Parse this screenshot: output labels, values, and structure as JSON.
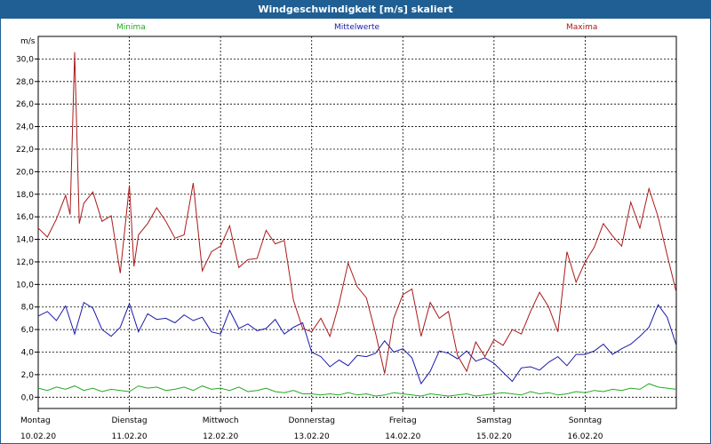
{
  "window": {
    "title": "Windgeschwindigkeit [m/s] skaliert"
  },
  "colors": {
    "minima": "#22aa22",
    "mittel": "#1a1aaa",
    "maxima": "#aa1a1a",
    "title_bg": "#1f5f94"
  },
  "chart_data": {
    "type": "line",
    "ylabel": "m/s",
    "ylim": [
      -1.0,
      32.0
    ],
    "yticks": [
      "0,0",
      "2,0",
      "4,0",
      "6,0",
      "8,0",
      "10,0",
      "12,0",
      "14,0",
      "16,0",
      "18,0",
      "20,0",
      "22,0",
      "24,0",
      "26,0",
      "28,0",
      "30,0"
    ],
    "ytick_values": [
      0,
      2,
      4,
      6,
      8,
      10,
      12,
      14,
      16,
      18,
      20,
      22,
      24,
      26,
      28,
      30
    ],
    "xlim": [
      0,
      7
    ],
    "days": [
      {
        "day": "Montag",
        "date": "10.02.20"
      },
      {
        "day": "Dienstag",
        "date": "11.02.20"
      },
      {
        "day": "Mittwoch",
        "date": "12.02.20"
      },
      {
        "day": "Donnerstag",
        "date": "13.02.20"
      },
      {
        "day": "Freitag",
        "date": "14.02.20"
      },
      {
        "day": "Samstag",
        "date": "15.02.20"
      },
      {
        "day": "Sonntag",
        "date": "16.02.20"
      }
    ],
    "grid": true,
    "series": [
      {
        "name": "Minima",
        "color": "#22aa22",
        "x": [
          0,
          0.1,
          0.2,
          0.3,
          0.4,
          0.5,
          0.6,
          0.7,
          0.8,
          0.9,
          1.0,
          1.1,
          1.2,
          1.3,
          1.4,
          1.5,
          1.6,
          1.7,
          1.8,
          1.9,
          2.0,
          2.1,
          2.2,
          2.3,
          2.4,
          2.5,
          2.6,
          2.7,
          2.8,
          2.9,
          3.0,
          3.1,
          3.2,
          3.3,
          3.4,
          3.5,
          3.6,
          3.7,
          3.8,
          3.9,
          4.0,
          4.1,
          4.2,
          4.3,
          4.4,
          4.5,
          4.6,
          4.7,
          4.8,
          4.9,
          5.0,
          5.1,
          5.2,
          5.3,
          5.4,
          5.5,
          5.6,
          5.7,
          5.8,
          5.9,
          6.0,
          6.1,
          6.2,
          6.3,
          6.4,
          6.5,
          6.6,
          6.7,
          6.8,
          6.9,
          7.0
        ],
        "values": [
          0.8,
          0.6,
          0.9,
          0.7,
          1.0,
          0.6,
          0.8,
          0.5,
          0.7,
          0.6,
          0.5,
          1.0,
          0.8,
          0.9,
          0.6,
          0.7,
          0.9,
          0.6,
          1.0,
          0.7,
          0.8,
          0.6,
          0.9,
          0.5,
          0.6,
          0.8,
          0.5,
          0.4,
          0.6,
          0.3,
          0.3,
          0.2,
          0.3,
          0.2,
          0.4,
          0.2,
          0.3,
          0.1,
          0.2,
          0.4,
          0.3,
          0.2,
          0.1,
          0.3,
          0.2,
          0.1,
          0.2,
          0.3,
          0.1,
          0.2,
          0.3,
          0.4,
          0.3,
          0.2,
          0.5,
          0.3,
          0.4,
          0.2,
          0.3,
          0.5,
          0.4,
          0.6,
          0.5,
          0.7,
          0.6,
          0.8,
          0.7,
          1.2,
          0.9,
          0.8,
          0.7
        ]
      },
      {
        "name": "Mittelwerte",
        "color": "#1a1aaa",
        "x": [
          0,
          0.1,
          0.2,
          0.3,
          0.4,
          0.5,
          0.6,
          0.7,
          0.8,
          0.9,
          1.0,
          1.1,
          1.2,
          1.3,
          1.4,
          1.5,
          1.6,
          1.7,
          1.8,
          1.9,
          2.0,
          2.1,
          2.2,
          2.3,
          2.4,
          2.5,
          2.6,
          2.7,
          2.8,
          2.9,
          3.0,
          3.1,
          3.2,
          3.3,
          3.4,
          3.5,
          3.6,
          3.7,
          3.8,
          3.9,
          4.0,
          4.1,
          4.2,
          4.3,
          4.4,
          4.5,
          4.6,
          4.7,
          4.8,
          4.9,
          5.0,
          5.1,
          5.2,
          5.3,
          5.4,
          5.5,
          5.6,
          5.7,
          5.8,
          5.9,
          6.0,
          6.1,
          6.2,
          6.3,
          6.4,
          6.5,
          6.6,
          6.7,
          6.8,
          6.9,
          7.0
        ],
        "values": [
          7.2,
          7.6,
          6.8,
          8.1,
          5.6,
          8.4,
          7.9,
          6.0,
          5.4,
          6.2,
          8.3,
          5.8,
          7.4,
          6.9,
          7.0,
          6.6,
          7.3,
          6.8,
          7.1,
          5.8,
          5.6,
          7.7,
          6.1,
          6.5,
          5.9,
          6.1,
          6.9,
          5.6,
          6.2,
          6.6,
          4.0,
          3.6,
          2.7,
          3.3,
          2.8,
          3.7,
          3.6,
          3.9,
          5.0,
          4.0,
          4.3,
          3.5,
          1.2,
          2.3,
          4.1,
          3.9,
          3.4,
          4.1,
          3.2,
          3.5,
          3.0,
          2.2,
          1.4,
          2.6,
          2.7,
          2.4,
          3.1,
          3.6,
          2.8,
          3.8,
          3.8,
          4.1,
          4.7,
          3.8,
          4.3,
          4.7,
          5.4,
          6.2,
          8.2,
          7.1,
          4.6
        ]
      },
      {
        "name": "Maxima",
        "color": "#aa1a1a",
        "x": [
          0,
          0.1,
          0.2,
          0.3,
          0.35,
          0.4,
          0.45,
          0.5,
          0.6,
          0.7,
          0.8,
          0.9,
          1.0,
          1.05,
          1.1,
          1.2,
          1.3,
          1.4,
          1.5,
          1.6,
          1.7,
          1.8,
          1.9,
          2.0,
          2.1,
          2.2,
          2.3,
          2.4,
          2.5,
          2.6,
          2.7,
          2.8,
          2.9,
          3.0,
          3.1,
          3.2,
          3.3,
          3.4,
          3.5,
          3.6,
          3.7,
          3.8,
          3.9,
          4.0,
          4.1,
          4.2,
          4.3,
          4.4,
          4.5,
          4.6,
          4.7,
          4.8,
          4.9,
          5.0,
          5.1,
          5.2,
          5.3,
          5.4,
          5.5,
          5.6,
          5.7,
          5.8,
          5.9,
          6.0,
          6.1,
          6.2,
          6.3,
          6.4,
          6.5,
          6.6,
          6.7,
          6.8,
          6.9,
          7.0
        ],
        "values": [
          15.0,
          14.2,
          15.8,
          17.9,
          16.2,
          30.6,
          15.4,
          17.2,
          18.2,
          15.6,
          16.1,
          11.0,
          18.8,
          11.6,
          14.4,
          15.4,
          16.8,
          15.6,
          14.1,
          14.4,
          19.0,
          11.2,
          12.9,
          13.4,
          15.2,
          11.5,
          12.2,
          12.3,
          14.8,
          13.6,
          13.9,
          8.6,
          6.1,
          5.8,
          7.0,
          5.4,
          8.3,
          11.9,
          9.8,
          8.8,
          5.7,
          2.1,
          7.0,
          9.1,
          9.6,
          5.4,
          8.4,
          7.0,
          7.6,
          3.7,
          2.3,
          4.9,
          3.6,
          5.1,
          4.6,
          6.0,
          5.6,
          7.6,
          9.3,
          8.0,
          5.8,
          12.9,
          10.2,
          12.0,
          13.3,
          15.4,
          14.3,
          13.4,
          17.3,
          15.0,
          18.5,
          16.0,
          12.6,
          9.3
        ]
      }
    ]
  }
}
